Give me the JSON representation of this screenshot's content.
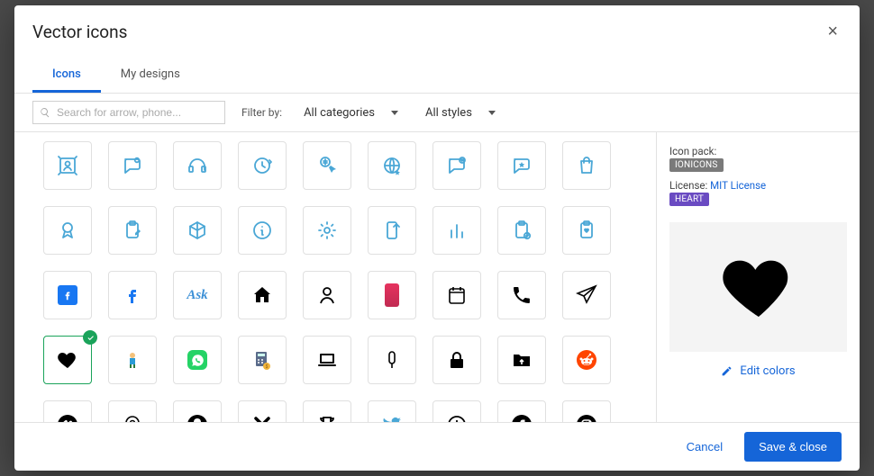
{
  "modal": {
    "title": "Vector icons",
    "close_glyph": "×"
  },
  "tabs": [
    {
      "id": "icons",
      "label": "Icons",
      "active": true
    },
    {
      "id": "mydesigns",
      "label": "My designs",
      "active": false
    }
  ],
  "toolbar": {
    "search_placeholder": "Search for arrow, phone...",
    "search_value": "",
    "filter_label": "Filter by:",
    "category_select": {
      "label": "All categories"
    },
    "style_select": {
      "label": "All styles"
    }
  },
  "grid_icons": [
    {
      "id": "target-person",
      "color": "#4aa7d6"
    },
    {
      "id": "chat-bubble-gear",
      "color": "#4aa7d6"
    },
    {
      "id": "headset",
      "color": "#4aa7d6"
    },
    {
      "id": "clock-refresh",
      "color": "#4aa7d6"
    },
    {
      "id": "dollar-touch",
      "color": "#4aa7d6"
    },
    {
      "id": "globe-star",
      "color": "#4aa7d6"
    },
    {
      "id": "chat-check",
      "color": "#4aa7d6"
    },
    {
      "id": "star-badge",
      "color": "#4aa7d6"
    },
    {
      "id": "shopping-bag",
      "color": "#4aa7d6"
    },
    {
      "id": "medal",
      "color": "#4aa7d6"
    },
    {
      "id": "clipboard-edit",
      "color": "#4aa7d6"
    },
    {
      "id": "cube",
      "color": "#4aa7d6"
    },
    {
      "id": "info-circle",
      "color": "#4aa7d6"
    },
    {
      "id": "gear",
      "color": "#4aa7d6"
    },
    {
      "id": "phone-arrow",
      "color": "#4aa7d6"
    },
    {
      "id": "bar-chart",
      "color": "#4aa7d6"
    },
    {
      "id": "clipboard-check",
      "color": "#4aa7d6"
    },
    {
      "id": "clipboard-heart",
      "color": "#4aa7d6"
    },
    {
      "id": "facebook-square",
      "color": "#1877f2"
    },
    {
      "id": "facebook-f",
      "color": "#1877f2"
    },
    {
      "id": "ask-script",
      "color": "#3b8fd6"
    },
    {
      "id": "home",
      "color": "#000"
    },
    {
      "id": "person-outline",
      "color": "#000"
    },
    {
      "id": "battery-red",
      "color": "#e6335f"
    },
    {
      "id": "calendar",
      "color": "#000"
    },
    {
      "id": "phone-handset",
      "color": "#000"
    },
    {
      "id": "paper-plane",
      "color": "#000"
    },
    {
      "id": "heart",
      "color": "#000",
      "selected": true
    },
    {
      "id": "mascot",
      "color": "#2a9bd6"
    },
    {
      "id": "whatsapp",
      "color": "#25d366"
    },
    {
      "id": "calculator-money",
      "color": "#c97e36"
    },
    {
      "id": "laptop",
      "color": "#000"
    },
    {
      "id": "popsicle",
      "color": "#000"
    },
    {
      "id": "lock",
      "color": "#000"
    },
    {
      "id": "folder-upload",
      "color": "#000"
    },
    {
      "id": "reddit",
      "color": "#ff4500"
    },
    {
      "id": "vimeo-circle",
      "color": "#000"
    },
    {
      "id": "map-pin",
      "color": "#000"
    },
    {
      "id": "snapchat-circle",
      "color": "#000"
    },
    {
      "id": "x-close",
      "color": "#000"
    },
    {
      "id": "trophy",
      "color": "#000"
    },
    {
      "id": "twitter-bird",
      "color": "#4aa7d6"
    },
    {
      "id": "clock-outline",
      "color": "#000"
    },
    {
      "id": "facebook-circle",
      "color": "#000"
    },
    {
      "id": "instagram-circle",
      "color": "#000"
    }
  ],
  "side_panel": {
    "pack_label": "Icon pack:",
    "pack_value": "IONICONS",
    "license_label": "License:",
    "license_value": "MIT License",
    "tag_value": "HEART",
    "selected_icon": "heart",
    "edit_colors_label": "Edit colors"
  },
  "footer": {
    "cancel_label": "Cancel",
    "save_label": "Save & close"
  }
}
